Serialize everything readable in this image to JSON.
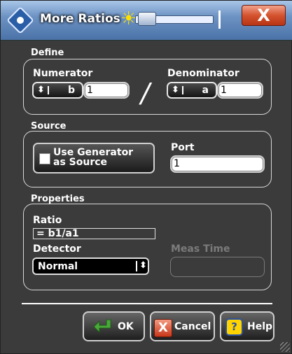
{
  "window": {
    "title": "More Ratios",
    "close_symbol": "X"
  },
  "define": {
    "group_label": "Define",
    "numerator_label": "Numerator",
    "numerator_select": "b",
    "numerator_value": "1",
    "denominator_label": "Denominator",
    "denominator_select": "a",
    "denominator_value": "1",
    "divider_symbol": "/"
  },
  "source": {
    "group_label": "Source",
    "use_generator_label_line1": "Use Generator",
    "use_generator_label_line2": "as Source",
    "port_label": "Port",
    "port_value": "1"
  },
  "properties": {
    "group_label": "Properties",
    "ratio_label": "Ratio",
    "ratio_value": "= b1/a1",
    "detector_label": "Detector",
    "detector_value": "Normal",
    "meas_time_label": "Meas Time",
    "meas_time_value": ""
  },
  "footer": {
    "ok_label": "OK",
    "cancel_label": "Cancel",
    "help_label": "Help",
    "help_icon_symbol": "?",
    "cancel_icon_symbol": "X"
  },
  "colors": {
    "background": "#3b3b3b",
    "titlebar": "#6d93c4",
    "close_button": "#d4532e",
    "help_icon": "#ffd400",
    "ok_arrow": "#4aa83a"
  },
  "icons": [
    "app-icon",
    "brightness-icon",
    "close-icon",
    "spin-arrows-icon",
    "checkbox-icon",
    "ok-arrow-icon",
    "cancel-icon",
    "help-icon"
  ]
}
